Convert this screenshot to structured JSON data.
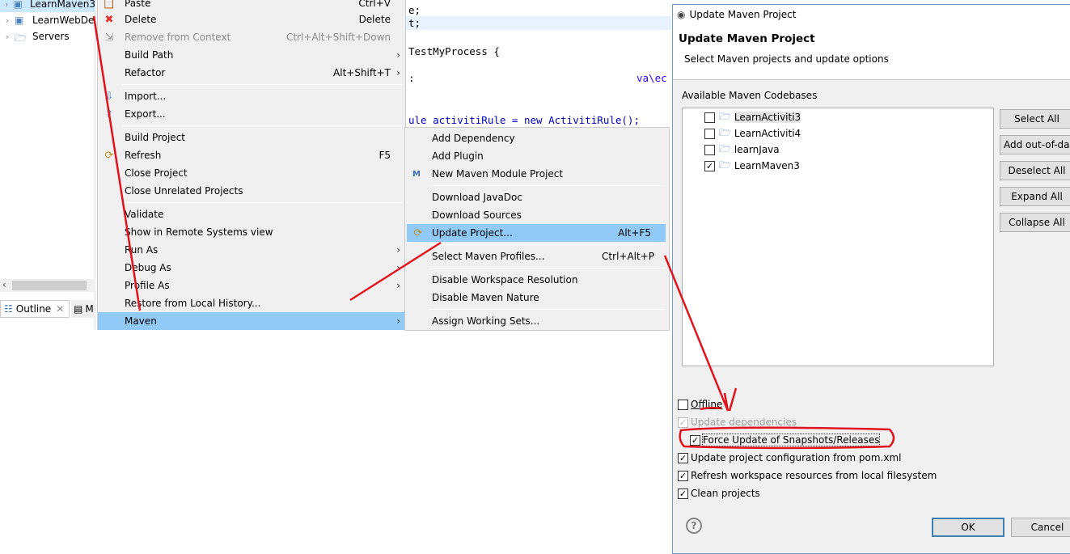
{
  "explorer": {
    "items": [
      {
        "label": "LearnMaven3",
        "selected": true
      },
      {
        "label": "LearnWebDe"
      },
      {
        "label": "Servers"
      }
    ],
    "outline_tab": "Outline",
    "second_tab": "M"
  },
  "editor": {
    "lines": [
      "e;",
      "t;",
      "TestMyProcess {",
      ":",
      "va\\ec",
      "ule activitiRule = new ActivitiRule();"
    ]
  },
  "context_menu": {
    "items": [
      {
        "label": "Paste",
        "shortcut": "Ctrl+V"
      },
      {
        "label": "Delete",
        "shortcut": "Delete"
      },
      {
        "label": "Remove from Context",
        "shortcut": "Ctrl+Alt+Shift+Down",
        "disabled": true
      },
      {
        "label": "Build Path",
        "submenu": true
      },
      {
        "label": "Refactor",
        "shortcut": "Alt+Shift+T",
        "submenu": true
      },
      {
        "label": "Import..."
      },
      {
        "label": "Export..."
      },
      {
        "label": "Build Project"
      },
      {
        "label": "Refresh",
        "shortcut": "F5"
      },
      {
        "label": "Close Project"
      },
      {
        "label": "Close Unrelated Projects"
      },
      {
        "label": "Validate"
      },
      {
        "label": "Show in Remote Systems view"
      },
      {
        "label": "Run As",
        "submenu": true
      },
      {
        "label": "Debug As",
        "submenu": true
      },
      {
        "label": "Profile As",
        "submenu": true
      },
      {
        "label": "Restore from Local History..."
      },
      {
        "label": "Maven",
        "submenu": true,
        "highlighted": true
      }
    ]
  },
  "maven_submenu": {
    "items": [
      {
        "label": "Add Dependency"
      },
      {
        "label": "Add Plugin"
      },
      {
        "label": "New Maven Module Project"
      },
      {
        "label": "Download JavaDoc"
      },
      {
        "label": "Download Sources"
      },
      {
        "label": "Update Project...",
        "shortcut": "Alt+F5",
        "highlighted": true
      },
      {
        "label": "Select Maven Profiles...",
        "shortcut": "Ctrl+Alt+P"
      },
      {
        "label": "Disable Workspace Resolution"
      },
      {
        "label": "Disable Maven Nature"
      },
      {
        "label": "Assign Working Sets..."
      }
    ]
  },
  "dialog": {
    "window_title": "Update Maven Project",
    "title": "Update Maven Project",
    "subtitle": "Select Maven projects and update options",
    "codebases_label": "Available Maven Codebases",
    "codebases": [
      {
        "label": "LearnActiviti3",
        "checked": false
      },
      {
        "label": "LearnActiviti4",
        "checked": false
      },
      {
        "label": "learnJava",
        "checked": false
      },
      {
        "label": "LearnMaven3",
        "checked": true
      }
    ],
    "buttons": {
      "select_all": "Select All",
      "add_out_of_date": "Add out-of-da",
      "deselect_all": "Deselect All",
      "expand_all": "Expand All",
      "collapse_all": "Collapse All"
    },
    "options": [
      {
        "label": "Offline",
        "checked": false
      },
      {
        "label": "Update dependencies",
        "checked": true,
        "disabled": true
      },
      {
        "label": "Force Update of Snapshots/Releases",
        "checked": true
      },
      {
        "label": "Update project configuration from pom.xml",
        "checked": true
      },
      {
        "label": "Refresh workspace resources from local filesystem",
        "checked": true
      },
      {
        "label": "Clean projects",
        "checked": true
      }
    ],
    "ok": "OK",
    "cancel": "Cancel"
  },
  "colors": {
    "menu_highlight": "#91c9f7",
    "annotation": "#e0141e"
  }
}
